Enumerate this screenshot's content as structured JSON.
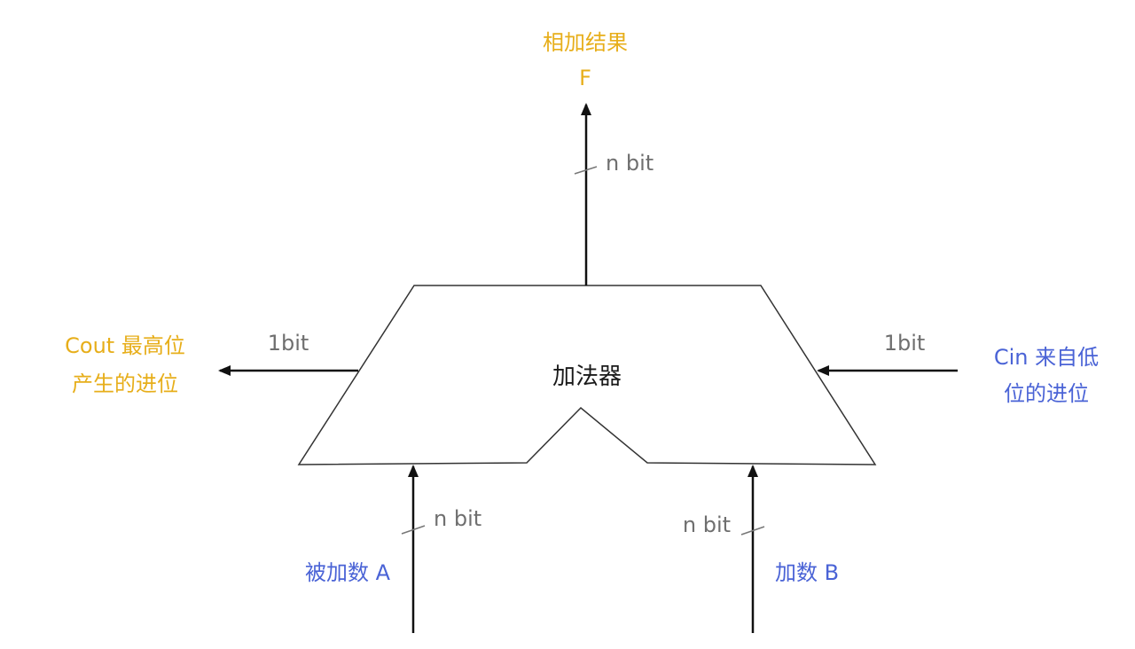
{
  "colors": {
    "output": "#E7AE1A",
    "input": "#4A63D6",
    "bitwidth": "#6F6F6F",
    "stroke": "#222222",
    "text": "#1a1a1a"
  },
  "adder": {
    "label": "加法器"
  },
  "output_f": {
    "line1": "相加结果",
    "line2": "F",
    "width": "n bit"
  },
  "cout": {
    "line1": "Cout 最高位",
    "line2": "产生的进位",
    "width": "1bit"
  },
  "cin": {
    "line1": "Cin 来自低",
    "line2": "位的进位",
    "width": "1bit"
  },
  "input_a": {
    "label": "被加数 A",
    "width": "n bit"
  },
  "input_b": {
    "label": "加数 B",
    "width": "n bit"
  }
}
